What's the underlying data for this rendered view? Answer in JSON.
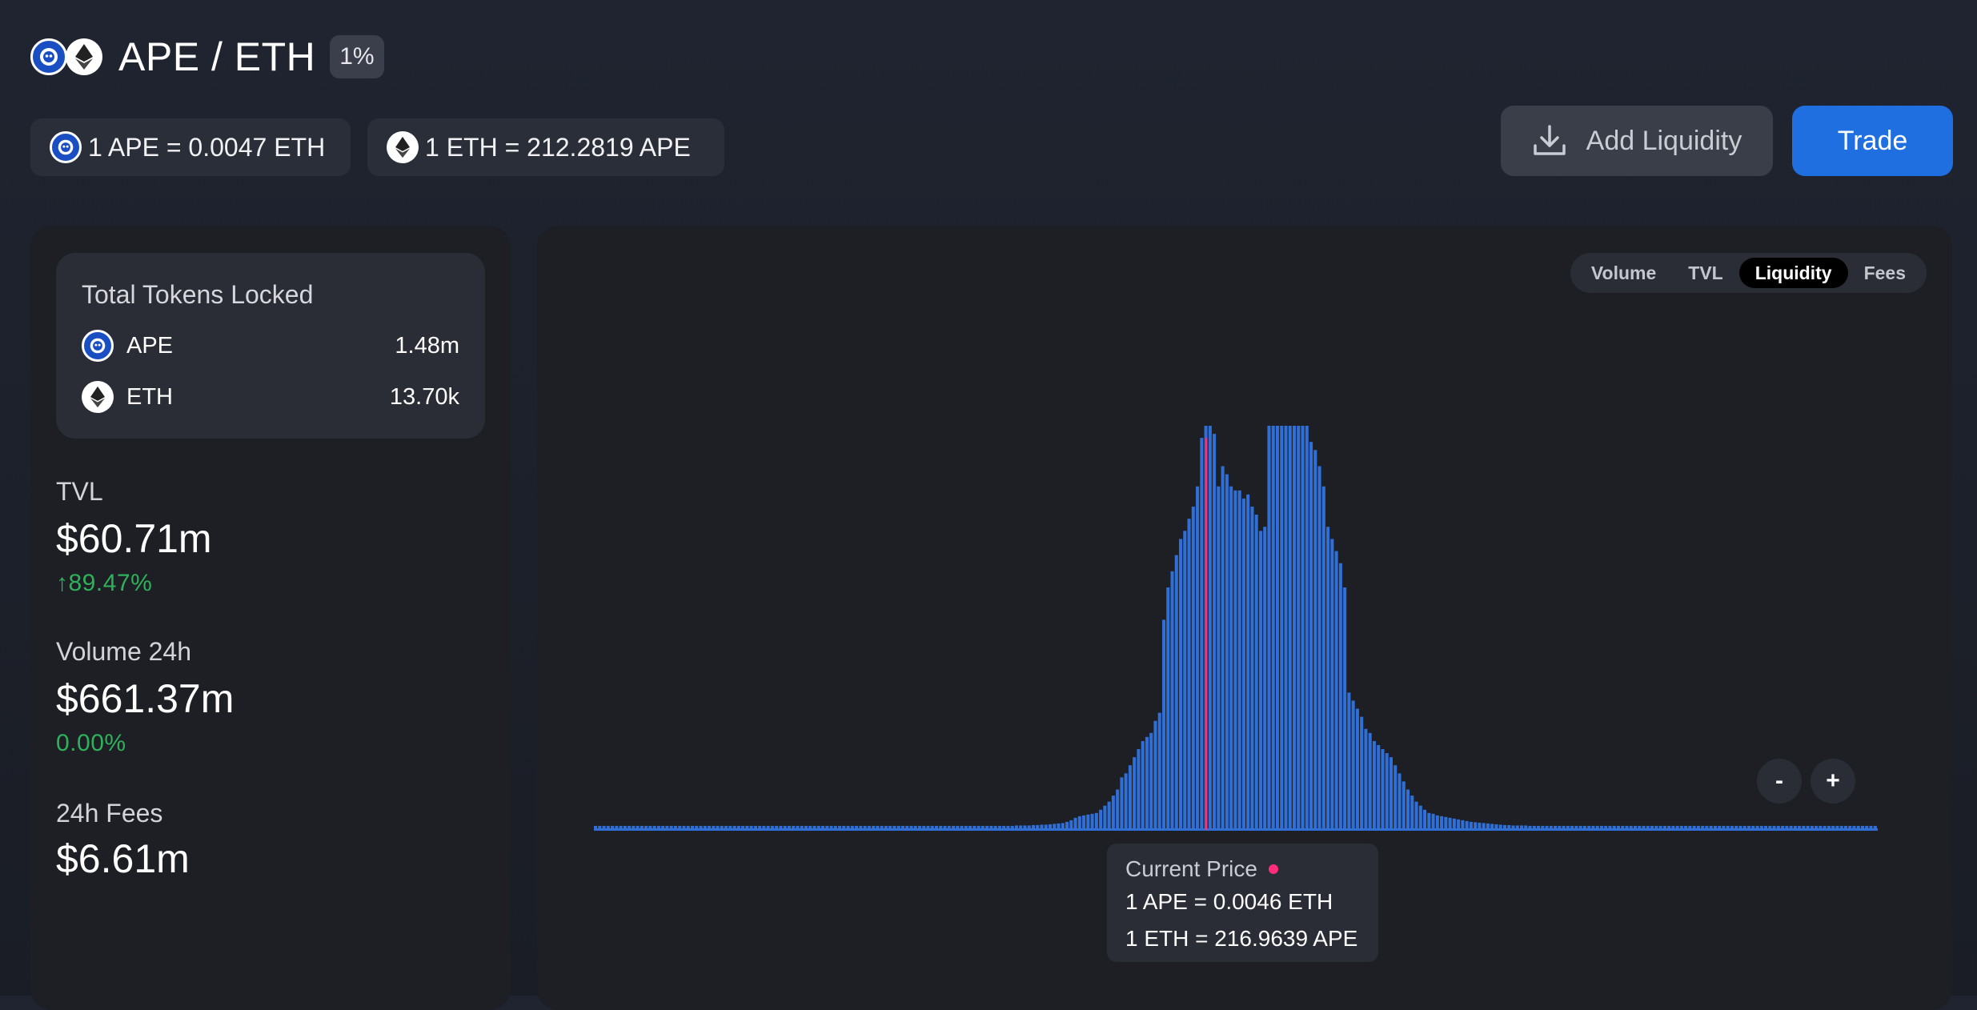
{
  "pair": {
    "title": "APE / ETH",
    "fee_tier": "1%",
    "token0_icon": "ape-logo",
    "token1_icon": "eth-logo"
  },
  "prices": {
    "ape_to_eth": "1 APE = 0.0047 ETH",
    "eth_to_ape": "1 ETH = 212.2819 APE"
  },
  "actions": {
    "add_liquidity_label": "Add Liquidity",
    "add_liquidity_icon": "download-icon",
    "trade_label": "Trade"
  },
  "locked": {
    "title": "Total Tokens Locked",
    "tokens": [
      {
        "symbol": "APE",
        "amount": "1.48m",
        "icon": "ape-logo"
      },
      {
        "symbol": "ETH",
        "amount": "13.70k",
        "icon": "eth-logo"
      }
    ]
  },
  "stats": {
    "tvl": {
      "label": "TVL",
      "value": "$60.71m",
      "change": "89.47%",
      "direction": "up"
    },
    "volume": {
      "label": "Volume 24h",
      "value": "$661.37m",
      "change": "0.00%"
    },
    "fees": {
      "label": "24h Fees",
      "value": "$6.61m"
    }
  },
  "chart_tabs": {
    "items": [
      "Volume",
      "TVL",
      "Liquidity",
      "Fees"
    ],
    "active": "Liquidity"
  },
  "zoom": {
    "out_label": "-",
    "in_label": "+"
  },
  "tooltip": {
    "title": "Current Price",
    "line1": "1 APE = 0.0046 ETH",
    "line2": "1 ETH = 216.9639 APE"
  },
  "colors": {
    "accent": "#1f6fe0",
    "bar": "#2f6fd6",
    "current_price": "#ff2d7a",
    "positive": "#2fb15c"
  },
  "chart_data": {
    "type": "bar",
    "description_values_are_relative_liquidity": true,
    "values": [
      0.01,
      0.01,
      0.01,
      0.01,
      0.01,
      0.01,
      0.01,
      0.01,
      0.01,
      0.01,
      0.01,
      0.01,
      0.01,
      0.01,
      0.01,
      0.01,
      0.01,
      0.01,
      0.01,
      0.01,
      0.01,
      0.01,
      0.01,
      0.01,
      0.01,
      0.01,
      0.01,
      0.01,
      0.01,
      0.01,
      0.01,
      0.01,
      0.01,
      0.01,
      0.01,
      0.01,
      0.01,
      0.01,
      0.01,
      0.01,
      0.01,
      0.01,
      0.01,
      0.01,
      0.01,
      0.01,
      0.01,
      0.01,
      0.01,
      0.01,
      0.01,
      0.01,
      0.01,
      0.01,
      0.01,
      0.01,
      0.01,
      0.01,
      0.01,
      0.01,
      0.01,
      0.01,
      0.01,
      0.01,
      0.01,
      0.01,
      0.01,
      0.01,
      0.01,
      0.01,
      0.01,
      0.01,
      0.01,
      0.01,
      0.01,
      0.01,
      0.01,
      0.01,
      0.01,
      0.01,
      0.01,
      0.01,
      0.01,
      0.01,
      0.01,
      0.01,
      0.01,
      0.01,
      0.01,
      0.01,
      0.01,
      0.01,
      0.01,
      0.01,
      0.01,
      0.01,
      0.01,
      0.01,
      0.01,
      0.01,
      0.011,
      0.011,
      0.011,
      0.011,
      0.012,
      0.012,
      0.013,
      0.013,
      0.014,
      0.015,
      0.016,
      0.017,
      0.02,
      0.024,
      0.03,
      0.034,
      0.036,
      0.038,
      0.04,
      0.042,
      0.05,
      0.06,
      0.07,
      0.085,
      0.1,
      0.13,
      0.14,
      0.16,
      0.18,
      0.2,
      0.22,
      0.23,
      0.24,
      0.27,
      0.29,
      0.52,
      0.6,
      0.64,
      0.68,
      0.72,
      0.74,
      0.77,
      0.8,
      0.85,
      0.97,
      1.0,
      1.0,
      0.98,
      0.85,
      0.9,
      0.88,
      0.85,
      0.84,
      0.84,
      0.82,
      0.83,
      0.8,
      0.78,
      0.74,
      0.75,
      1.0,
      1.0,
      1.0,
      1.0,
      1.0,
      1.0,
      1.0,
      1.0,
      1.0,
      1.0,
      0.96,
      0.94,
      0.9,
      0.85,
      0.75,
      0.72,
      0.69,
      0.66,
      0.6,
      0.34,
      0.32,
      0.3,
      0.28,
      0.25,
      0.24,
      0.22,
      0.21,
      0.2,
      0.19,
      0.18,
      0.16,
      0.14,
      0.12,
      0.1,
      0.085,
      0.07,
      0.06,
      0.05,
      0.042,
      0.04,
      0.036,
      0.034,
      0.032,
      0.03,
      0.028,
      0.026,
      0.024,
      0.022,
      0.02,
      0.019,
      0.018,
      0.017,
      0.016,
      0.015,
      0.014,
      0.013,
      0.012,
      0.012,
      0.011,
      0.011,
      0.011,
      0.011,
      0.01,
      0.01,
      0.01,
      0.01,
      0.01,
      0.01,
      0.01,
      0.01,
      0.01,
      0.01,
      0.01,
      0.01,
      0.01,
      0.01,
      0.01,
      0.01,
      0.01,
      0.01,
      0.01,
      0.01,
      0.01,
      0.01,
      0.01,
      0.01,
      0.01,
      0.01,
      0.01,
      0.01,
      0.01,
      0.01,
      0.01,
      0.01,
      0.01,
      0.01,
      0.01,
      0.01,
      0.01,
      0.01,
      0.01,
      0.01,
      0.01,
      0.01,
      0.01,
      0.01,
      0.01,
      0.01,
      0.01,
      0.01,
      0.01,
      0.01,
      0.01,
      0.01,
      0.01,
      0.01,
      0.01,
      0.01,
      0.01,
      0.01,
      0.01,
      0.01,
      0.01,
      0.01,
      0.01,
      0.01,
      0.01,
      0.01,
      0.01,
      0.01,
      0.01,
      0.01,
      0.01,
      0.01,
      0.01,
      0.01,
      0.01,
      0.01,
      0.01,
      0.01,
      0.01,
      0.01,
      0.01,
      0.01,
      0.01
    ],
    "current_price_index": 145
  }
}
